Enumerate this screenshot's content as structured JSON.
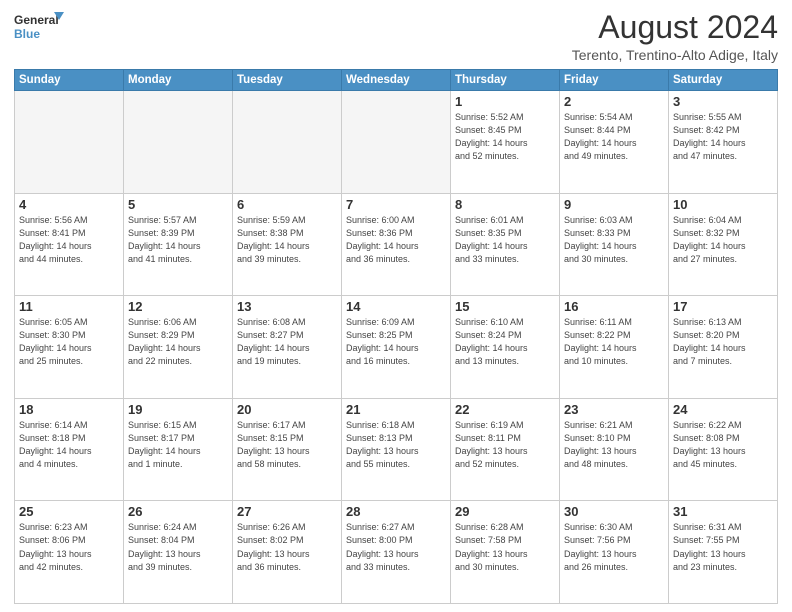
{
  "logo": {
    "line1": "General",
    "line2": "Blue"
  },
  "title": "August 2024",
  "subtitle": "Terento, Trentino-Alto Adige, Italy",
  "days_of_week": [
    "Sunday",
    "Monday",
    "Tuesday",
    "Wednesday",
    "Thursday",
    "Friday",
    "Saturday"
  ],
  "weeks": [
    [
      {
        "day": "",
        "info": ""
      },
      {
        "day": "",
        "info": ""
      },
      {
        "day": "",
        "info": ""
      },
      {
        "day": "",
        "info": ""
      },
      {
        "day": "1",
        "info": "Sunrise: 5:52 AM\nSunset: 8:45 PM\nDaylight: 14 hours\nand 52 minutes."
      },
      {
        "day": "2",
        "info": "Sunrise: 5:54 AM\nSunset: 8:44 PM\nDaylight: 14 hours\nand 49 minutes."
      },
      {
        "day": "3",
        "info": "Sunrise: 5:55 AM\nSunset: 8:42 PM\nDaylight: 14 hours\nand 47 minutes."
      }
    ],
    [
      {
        "day": "4",
        "info": "Sunrise: 5:56 AM\nSunset: 8:41 PM\nDaylight: 14 hours\nand 44 minutes."
      },
      {
        "day": "5",
        "info": "Sunrise: 5:57 AM\nSunset: 8:39 PM\nDaylight: 14 hours\nand 41 minutes."
      },
      {
        "day": "6",
        "info": "Sunrise: 5:59 AM\nSunset: 8:38 PM\nDaylight: 14 hours\nand 39 minutes."
      },
      {
        "day": "7",
        "info": "Sunrise: 6:00 AM\nSunset: 8:36 PM\nDaylight: 14 hours\nand 36 minutes."
      },
      {
        "day": "8",
        "info": "Sunrise: 6:01 AM\nSunset: 8:35 PM\nDaylight: 14 hours\nand 33 minutes."
      },
      {
        "day": "9",
        "info": "Sunrise: 6:03 AM\nSunset: 8:33 PM\nDaylight: 14 hours\nand 30 minutes."
      },
      {
        "day": "10",
        "info": "Sunrise: 6:04 AM\nSunset: 8:32 PM\nDaylight: 14 hours\nand 27 minutes."
      }
    ],
    [
      {
        "day": "11",
        "info": "Sunrise: 6:05 AM\nSunset: 8:30 PM\nDaylight: 14 hours\nand 25 minutes."
      },
      {
        "day": "12",
        "info": "Sunrise: 6:06 AM\nSunset: 8:29 PM\nDaylight: 14 hours\nand 22 minutes."
      },
      {
        "day": "13",
        "info": "Sunrise: 6:08 AM\nSunset: 8:27 PM\nDaylight: 14 hours\nand 19 minutes."
      },
      {
        "day": "14",
        "info": "Sunrise: 6:09 AM\nSunset: 8:25 PM\nDaylight: 14 hours\nand 16 minutes."
      },
      {
        "day": "15",
        "info": "Sunrise: 6:10 AM\nSunset: 8:24 PM\nDaylight: 14 hours\nand 13 minutes."
      },
      {
        "day": "16",
        "info": "Sunrise: 6:11 AM\nSunset: 8:22 PM\nDaylight: 14 hours\nand 10 minutes."
      },
      {
        "day": "17",
        "info": "Sunrise: 6:13 AM\nSunset: 8:20 PM\nDaylight: 14 hours\nand 7 minutes."
      }
    ],
    [
      {
        "day": "18",
        "info": "Sunrise: 6:14 AM\nSunset: 8:18 PM\nDaylight: 14 hours\nand 4 minutes."
      },
      {
        "day": "19",
        "info": "Sunrise: 6:15 AM\nSunset: 8:17 PM\nDaylight: 14 hours\nand 1 minute."
      },
      {
        "day": "20",
        "info": "Sunrise: 6:17 AM\nSunset: 8:15 PM\nDaylight: 13 hours\nand 58 minutes."
      },
      {
        "day": "21",
        "info": "Sunrise: 6:18 AM\nSunset: 8:13 PM\nDaylight: 13 hours\nand 55 minutes."
      },
      {
        "day": "22",
        "info": "Sunrise: 6:19 AM\nSunset: 8:11 PM\nDaylight: 13 hours\nand 52 minutes."
      },
      {
        "day": "23",
        "info": "Sunrise: 6:21 AM\nSunset: 8:10 PM\nDaylight: 13 hours\nand 48 minutes."
      },
      {
        "day": "24",
        "info": "Sunrise: 6:22 AM\nSunset: 8:08 PM\nDaylight: 13 hours\nand 45 minutes."
      }
    ],
    [
      {
        "day": "25",
        "info": "Sunrise: 6:23 AM\nSunset: 8:06 PM\nDaylight: 13 hours\nand 42 minutes."
      },
      {
        "day": "26",
        "info": "Sunrise: 6:24 AM\nSunset: 8:04 PM\nDaylight: 13 hours\nand 39 minutes."
      },
      {
        "day": "27",
        "info": "Sunrise: 6:26 AM\nSunset: 8:02 PM\nDaylight: 13 hours\nand 36 minutes."
      },
      {
        "day": "28",
        "info": "Sunrise: 6:27 AM\nSunset: 8:00 PM\nDaylight: 13 hours\nand 33 minutes."
      },
      {
        "day": "29",
        "info": "Sunrise: 6:28 AM\nSunset: 7:58 PM\nDaylight: 13 hours\nand 30 minutes."
      },
      {
        "day": "30",
        "info": "Sunrise: 6:30 AM\nSunset: 7:56 PM\nDaylight: 13 hours\nand 26 minutes."
      },
      {
        "day": "31",
        "info": "Sunrise: 6:31 AM\nSunset: 7:55 PM\nDaylight: 13 hours\nand 23 minutes."
      }
    ]
  ]
}
